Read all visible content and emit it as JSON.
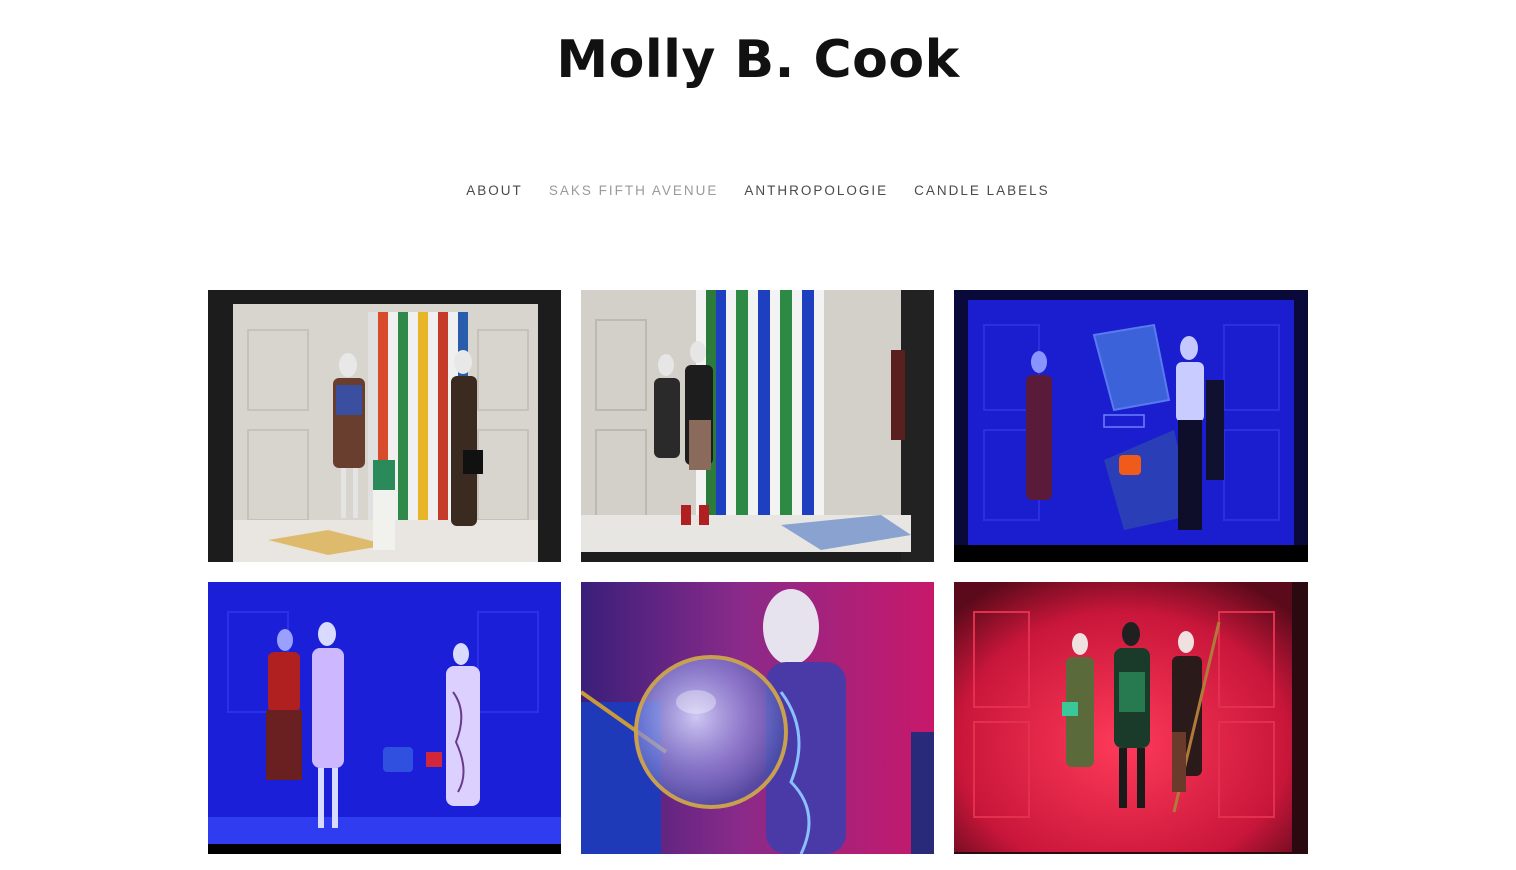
{
  "site": {
    "title": "Molly B. Cook"
  },
  "nav": {
    "items": [
      {
        "label": "ABOUT",
        "active": false
      },
      {
        "label": "SAKS FIFTH AVENUE",
        "active": true
      },
      {
        "label": "ANTHROPOLOGIE",
        "active": false
      },
      {
        "label": "CANDLE LABELS",
        "active": false
      }
    ]
  },
  "gallery": {
    "items": [
      {
        "name": "window-photo-1",
        "scene": "white paneled window with vertical rainbow stripes, two mannequins"
      },
      {
        "name": "window-photo-2",
        "scene": "white paneled window with blue and green stripes, two mannequins"
      },
      {
        "name": "window-photo-3",
        "scene": "blue lit window with chair and two mannequins"
      },
      {
        "name": "window-photo-4",
        "scene": "blue lit window with three mannequins and chair"
      },
      {
        "name": "window-photo-5",
        "scene": "magenta lit close-up mannequin with glass sphere"
      },
      {
        "name": "window-photo-6",
        "scene": "red lit window with four mannequins"
      }
    ],
    "palette": {
      "wall_white": "#d9d6d0",
      "frame_dark": "#1a1a1a",
      "blue_light": "#1a1fd6",
      "magenta": "#c2186b",
      "red": "#d8203c"
    }
  }
}
